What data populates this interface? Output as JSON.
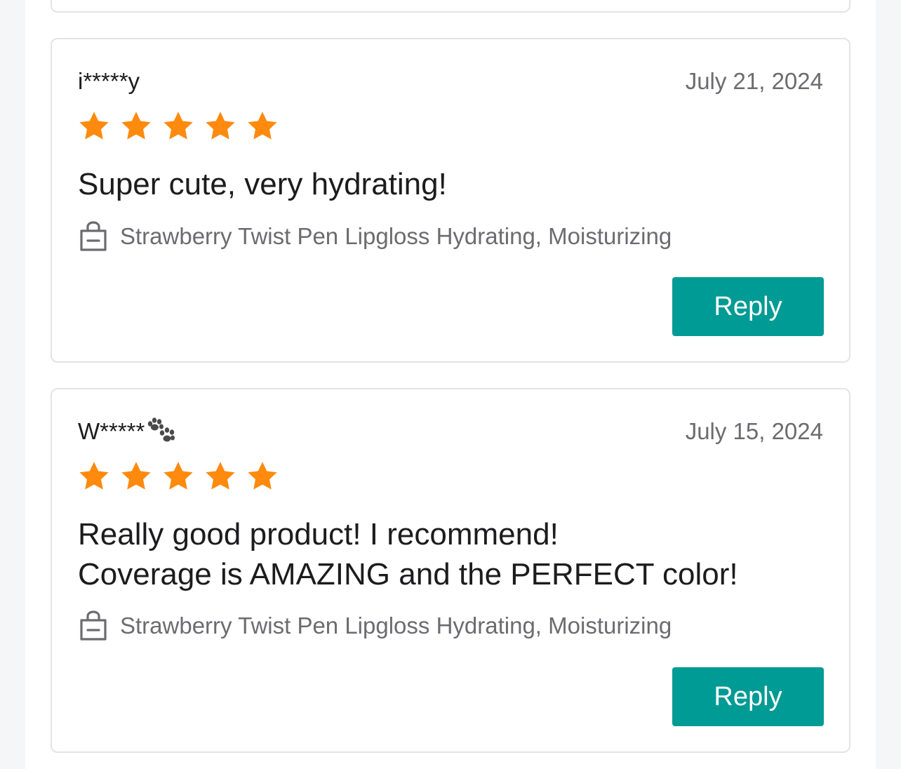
{
  "reviews": [
    {
      "username": "i*****y",
      "date": "July 21, 2024",
      "rating": 5,
      "text_lines": [
        "Super cute, very hydrating!"
      ],
      "product": "Strawberry Twist Pen Lipgloss Hydrating, Moisturizing",
      "reply_label": "Reply"
    },
    {
      "username": "W*****",
      "username_icon": "paw-icon",
      "date": "July 15, 2024",
      "rating": 5,
      "text_lines": [
        "Really good product! I recommend!",
        "Coverage is AMAZING and the PERFECT color!"
      ],
      "product": "Strawberry Twist Pen Lipgloss Hydrating, Moisturizing",
      "reply_label": "Reply"
    }
  ],
  "colors": {
    "star": "#ff8a0d",
    "reply_button": "#009b94",
    "text_primary": "#1c1c1e",
    "text_secondary": "#6b6b70",
    "card_border": "#e3e4e7"
  }
}
